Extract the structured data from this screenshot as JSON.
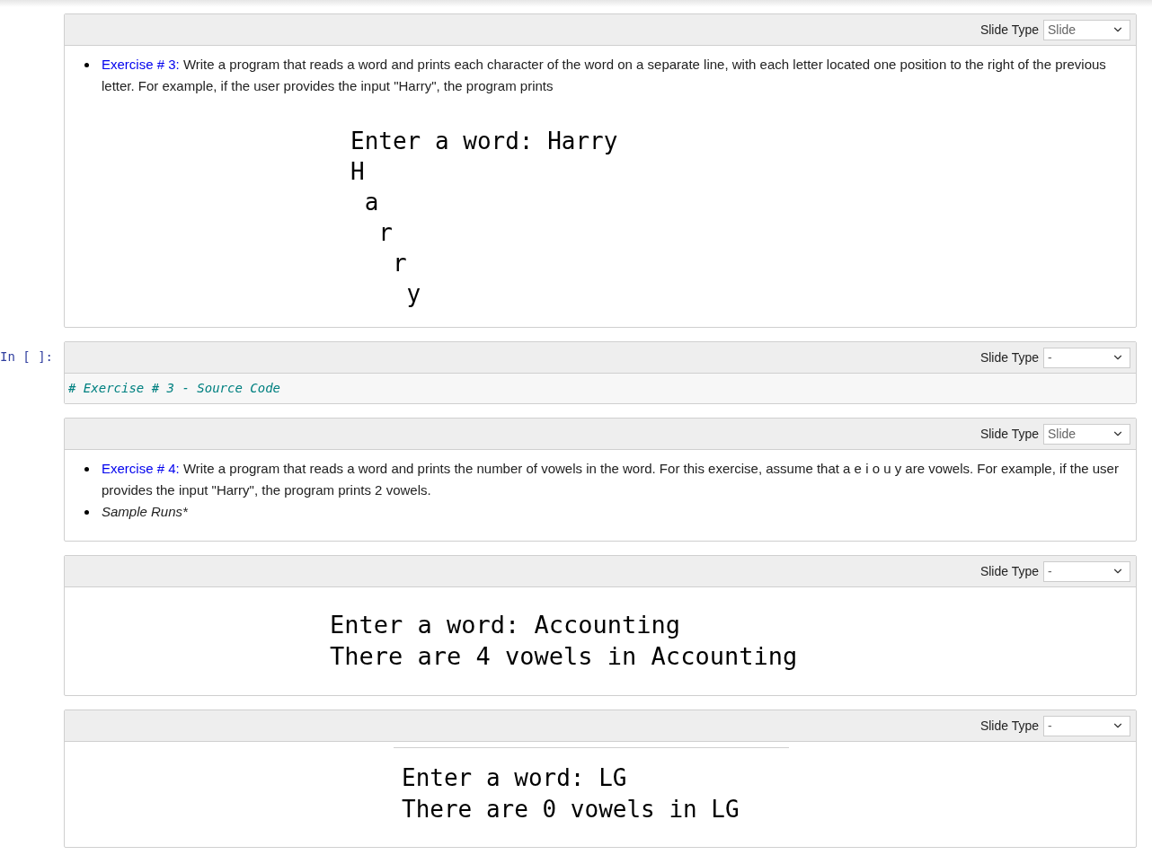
{
  "cells": [
    {
      "kind": "markdown",
      "slide_type_label": "Slide Type",
      "slide_type": "Slide",
      "bullets": [
        {
          "kind": "exercise",
          "link": "Exercise # 3:",
          "text": "Write a program that reads a word and prints each character of the word on a separate line, with each letter located one position to the right of the previous letter. For example, if the user provides the input \"Harry\", the program prints"
        }
      ],
      "output": {
        "rule": false,
        "lines": [
          "Enter a word: Harry",
          "H",
          " a",
          "  r",
          "   r",
          "    y"
        ]
      }
    },
    {
      "kind": "code",
      "prompt": "In [ ]:",
      "slide_type_label": "Slide Type",
      "slide_type": "-",
      "code": "# Exercise # 3 - Source Code"
    },
    {
      "kind": "markdown",
      "slide_type_label": "Slide Type",
      "slide_type": "Slide",
      "bullets": [
        {
          "kind": "exercise",
          "link": "Exercise # 4:",
          "text": "Write a program that reads a word and prints the number of vowels in the word. For this exercise, assume that a e i o u y are vowels. For example, if the user provides the input \"Harry\", the program prints 2 vowels."
        },
        {
          "kind": "italic",
          "text": "Sample Runs*"
        }
      ]
    },
    {
      "kind": "markdown",
      "slide_type_label": "Slide Type",
      "slide_type": "-",
      "output": {
        "rule": false,
        "lines": [
          "Enter a word: Accounting",
          "There are 4 vowels in Accounting"
        ]
      }
    },
    {
      "kind": "markdown",
      "slide_type_label": "Slide Type",
      "slide_type": "-",
      "output": {
        "rule": true,
        "lines": [
          "Enter a word: LG",
          "There are 0 vowels in LG"
        ]
      }
    }
  ]
}
